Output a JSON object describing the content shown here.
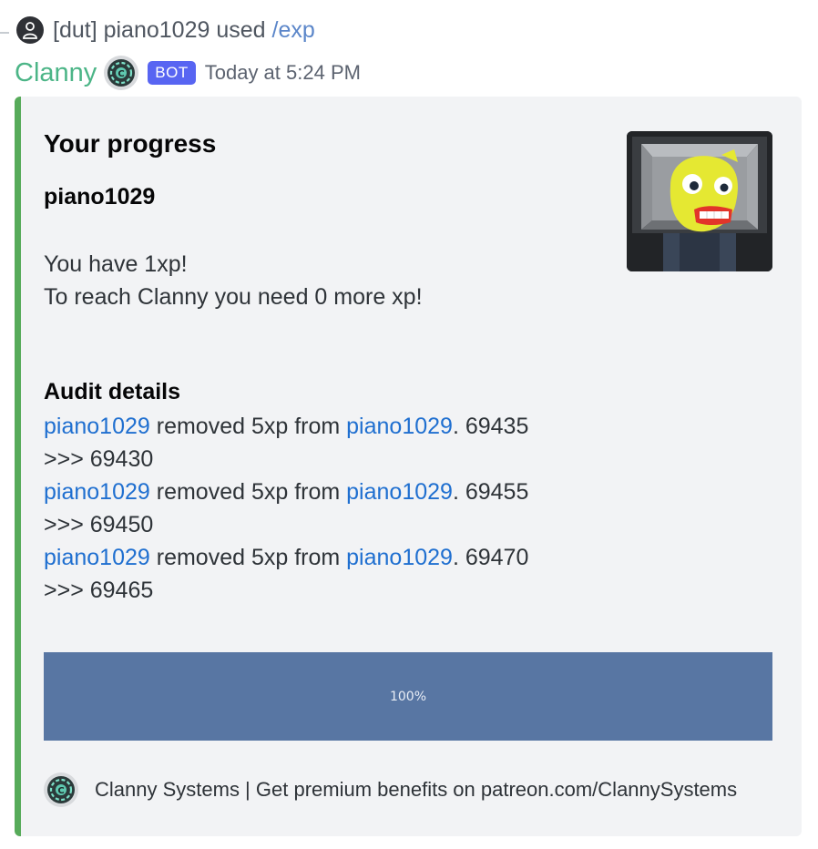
{
  "reply": {
    "text": "[dut] piano1029 used",
    "command": "/exp"
  },
  "author": {
    "name": "Clanny",
    "bot_tag": "BOT",
    "timestamp": "Today at 5:24 PM"
  },
  "embed": {
    "accent_color": "#57ab5a",
    "title": "Your progress",
    "subtitle": "piano1029",
    "description_lines": [
      "You have 1xp!",
      "To reach Clanny you need 0 more xp!"
    ],
    "audit_title": "Audit details",
    "audit_entries": [
      {
        "user": "piano1029",
        "action": " removed 5xp from ",
        "target": "piano1029",
        "suffix": ". 69435",
        "line2": ">>> 69430"
      },
      {
        "user": "piano1029",
        "action": " removed 5xp from ",
        "target": "piano1029",
        "suffix": ". 69455",
        "line2": ">>> 69450"
      },
      {
        "user": "piano1029",
        "action": " removed 5xp from ",
        "target": "piano1029",
        "suffix": ". 69470",
        "line2": ">>> 69465"
      }
    ],
    "progress": {
      "value": 1.0,
      "label": "100%"
    },
    "footer": {
      "icon": "clanny-logo-icon",
      "text": "Clanny Systems | Get premium benefits on patreon.com/ClannySystems"
    },
    "thumbnail": {
      "icon": "yellow-character-thumbnail"
    }
  },
  "colors": {
    "author_name": "#4cb587",
    "link": "#1f6fd0",
    "command": "#5b86c9",
    "bot_tag": "#5865f2",
    "progress_fill": "#5876a3"
  }
}
